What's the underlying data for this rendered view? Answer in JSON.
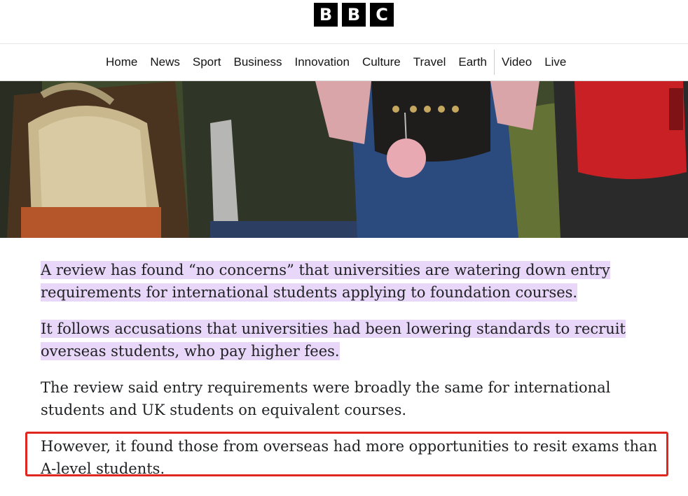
{
  "logo": {
    "letters": [
      "B",
      "B",
      "C"
    ]
  },
  "nav": {
    "items": [
      "Home",
      "News",
      "Sport",
      "Business",
      "Innovation",
      "Culture",
      "Travel",
      "Earth",
      "Video",
      "Live"
    ]
  },
  "article": {
    "paragraphs": [
      {
        "text": "A review has found “no concerns” that universities are watering down entry requirements for international students applying to foundation courses.",
        "highlighted": true
      },
      {
        "text": "It follows accusations that universities had been lowering standards to recruit overseas students, who pay higher fees.",
        "highlighted": true
      },
      {
        "text": "The review said entry requirements were broadly the same for international students and UK students on equivalent courses.",
        "highlighted": false
      },
      {
        "text": "However, it found those from overseas had more opportunities to resit exams than A-level students.",
        "highlighted": false
      }
    ]
  },
  "colors": {
    "highlight": "#e8d7f8",
    "annotation_box": "#e0271f"
  }
}
